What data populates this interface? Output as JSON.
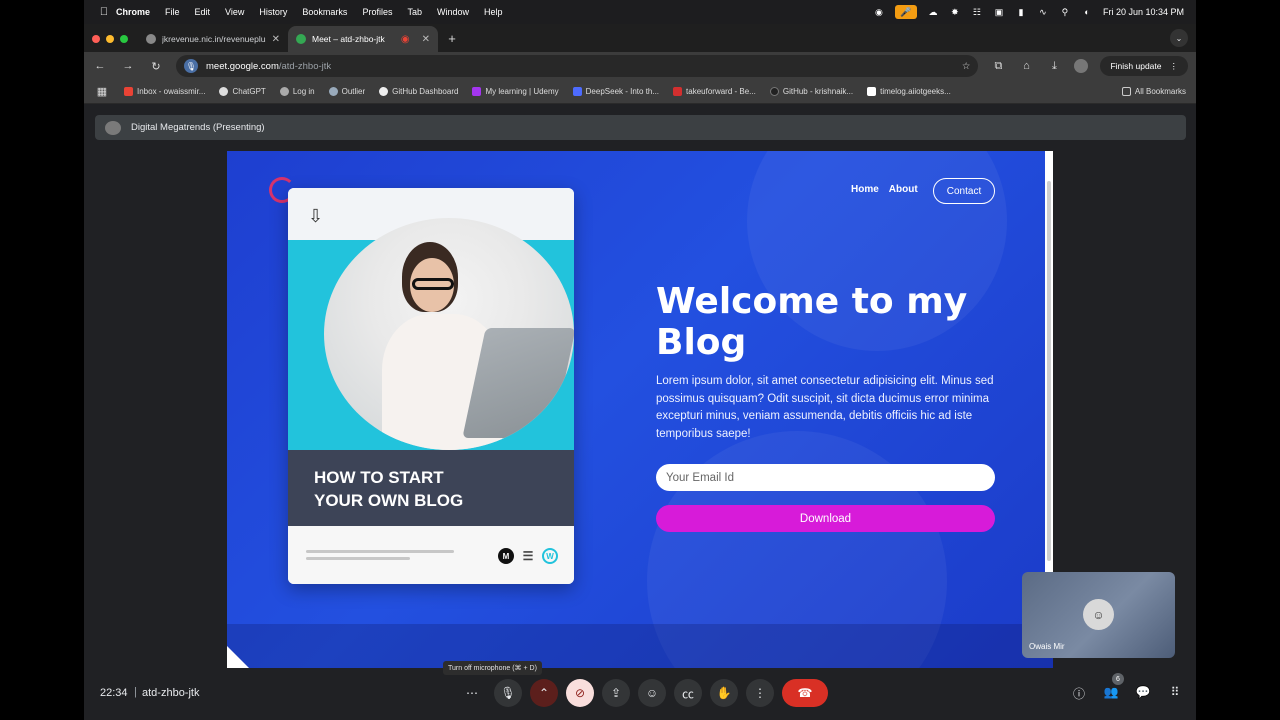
{
  "menubar": {
    "items": [
      "Chrome",
      "File",
      "Edit",
      "View",
      "History",
      "Bookmarks",
      "Profiles",
      "Tab",
      "Window",
      "Help"
    ],
    "datetime": "Fri 20 Jun  10:34 PM"
  },
  "tabs": [
    {
      "title": "jkrevenue.nic.in/revenueplus/"
    },
    {
      "title": "Meet – atd-zhbo-jtk"
    }
  ],
  "address": {
    "host": "meet.google.com",
    "path": "/atd-zhbo-jtk"
  },
  "toolbar": {
    "finish_update": "Finish update"
  },
  "bookmarks": [
    "Inbox - owaissmir...",
    "ChatGPT",
    "Log in",
    "Outlier",
    "GitHub Dashboard",
    "My learning | Udemy",
    "DeepSeek - Into th...",
    "takeuforward - Be...",
    "GitHub - krishnaik...",
    "timelog.aiiotgeeks..."
  ],
  "all_bookmarks": "All Bookmarks",
  "presenting": "Digital Megatrends (Presenting)",
  "slide": {
    "nav": [
      "Home",
      "About"
    ],
    "contact": "Contact",
    "card_title_line1": "HOW TO START",
    "card_title_line2": "YOUR OWN BLOG",
    "card_icon_letter": "M",
    "hero_title_line1": "Welcome to my",
    "hero_title_line2": "Blog",
    "hero_text": "Lorem ipsum dolor, sit amet consectetur adipisicing elit. Minus sed possimus quisquam? Odit suscipit, sit dicta ducimus error minima excepturi minus, veniam assumenda, debitis officiis hic ad iste temporibus saepe!",
    "email_placeholder": "Your Email Id",
    "download": "Download"
  },
  "self_tile": {
    "name": "Owais Mir"
  },
  "tooltip": "Turn off microphone (⌘ + D)",
  "bottom": {
    "time": "22:34",
    "separator": "|",
    "meeting_code": "atd-zhbo-jtk",
    "people_count": "6"
  },
  "colors": {
    "accent_blue": "#1f48d8",
    "download": "#d71bd9",
    "end_call": "#d93025"
  }
}
